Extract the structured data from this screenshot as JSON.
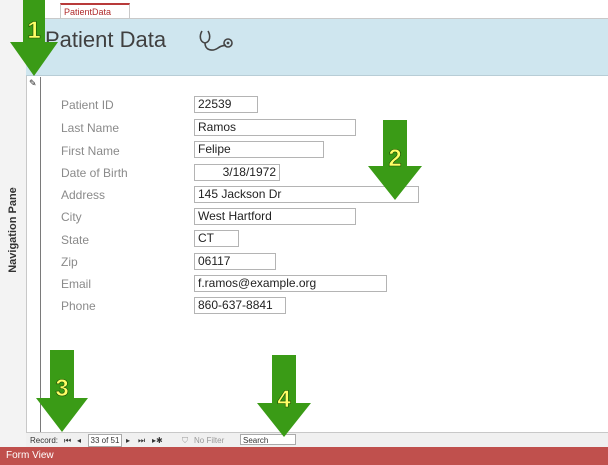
{
  "window": {
    "tab_label": "PatientData",
    "nav_pane_label": "Navigation Pane",
    "status": "Form View"
  },
  "form": {
    "title": "Patient Data",
    "logo_icon": "stethoscope-icon",
    "fields": [
      {
        "label": "Patient ID",
        "value": "22539"
      },
      {
        "label": "Last Name",
        "value": "Ramos"
      },
      {
        "label": "First Name",
        "value": "Felipe"
      },
      {
        "label": "Date of Birth",
        "value": "3/18/1972"
      },
      {
        "label": "Address",
        "value": "145 Jackson Dr"
      },
      {
        "label": "City",
        "value": "West Hartford"
      },
      {
        "label": "State",
        "value": "CT"
      },
      {
        "label": "Zip",
        "value": "06117"
      },
      {
        "label": "Email",
        "value": "f.ramos@example.org"
      },
      {
        "label": "Phone",
        "value": "860-637-8841"
      }
    ]
  },
  "record_nav": {
    "label": "Record:",
    "first_glyph": "⏮",
    "prev_glyph": "◂",
    "position": "33 of 51",
    "next_glyph": "▸",
    "last_glyph": "⏭",
    "new_glyph": "▸✱",
    "filter_label": "No Filter",
    "search_placeholder": "Search"
  },
  "callouts": {
    "one": "1",
    "two": "2",
    "three": "3",
    "four": "4",
    "color": "#3a9b16"
  }
}
